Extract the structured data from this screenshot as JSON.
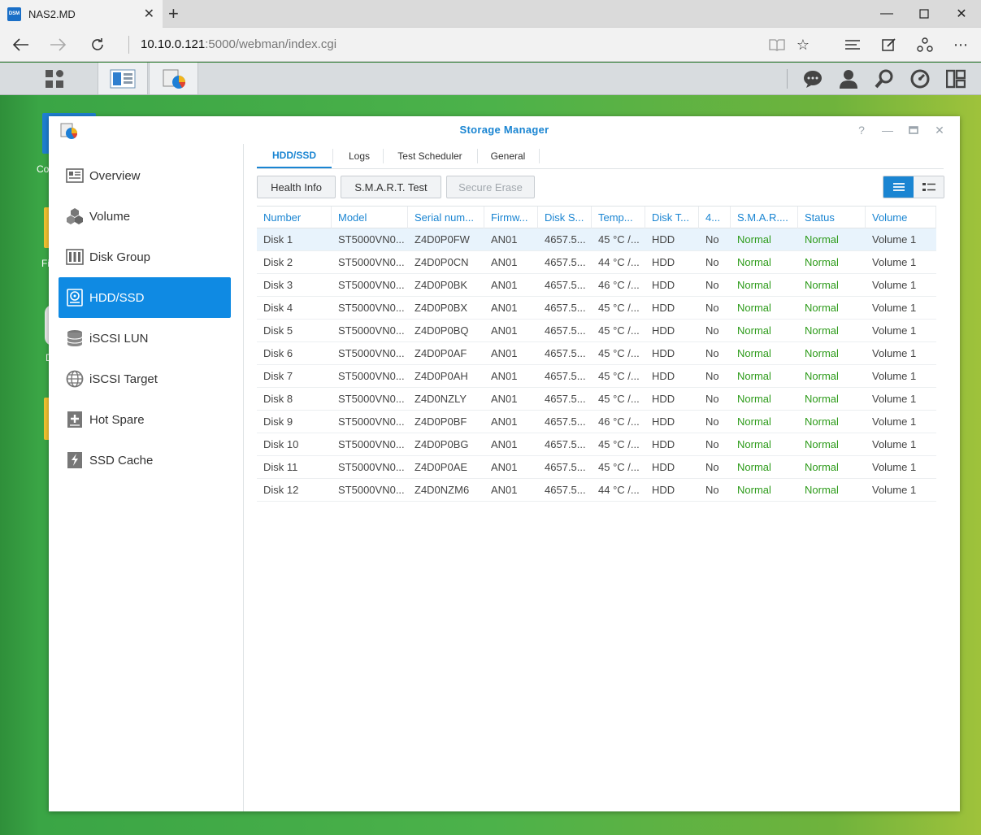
{
  "browser": {
    "tab_title": "NAS2.MD",
    "favicon_text": "DSM",
    "url_host": "10.10.0.121",
    "url_rest": ":5000/webman/index.cgi"
  },
  "desktop": {
    "labels": [
      "Co",
      "Fi",
      "D"
    ]
  },
  "window": {
    "title": "Storage Manager"
  },
  "sidebar": {
    "items": [
      {
        "label": "Overview",
        "icon": "overview-icon"
      },
      {
        "label": "Volume",
        "icon": "volume-icon"
      },
      {
        "label": "Disk Group",
        "icon": "disk-group-icon"
      },
      {
        "label": "HDD/SSD",
        "icon": "hdd-icon",
        "active": true
      },
      {
        "label": "iSCSI LUN",
        "icon": "iscsi-lun-icon"
      },
      {
        "label": "iSCSI Target",
        "icon": "iscsi-target-icon"
      },
      {
        "label": "Hot Spare",
        "icon": "hot-spare-icon"
      },
      {
        "label": "SSD Cache",
        "icon": "ssd-cache-icon"
      }
    ]
  },
  "tabs": [
    "HDD/SSD",
    "Logs",
    "Test Scheduler",
    "General"
  ],
  "toolbar": {
    "health_info": "Health Info",
    "smart_test": "S.M.A.R.T. Test",
    "secure_erase": "Secure Erase"
  },
  "table": {
    "columns": [
      "Number",
      "Model",
      "Serial num...",
      "Firmw...",
      "Disk S...",
      "Temp...",
      "Disk T...",
      "4...",
      "S.M.A.R....",
      "Status",
      "Volume"
    ],
    "rows": [
      [
        "Disk 1",
        "ST5000VN0...",
        "Z4D0P0FW",
        "AN01",
        "4657.5...",
        "45 °C /...",
        "HDD",
        "No",
        "Normal",
        "Normal",
        "Volume 1"
      ],
      [
        "Disk 2",
        "ST5000VN0...",
        "Z4D0P0CN",
        "AN01",
        "4657.5...",
        "44 °C /...",
        "HDD",
        "No",
        "Normal",
        "Normal",
        "Volume 1"
      ],
      [
        "Disk 3",
        "ST5000VN0...",
        "Z4D0P0BK",
        "AN01",
        "4657.5...",
        "46 °C /...",
        "HDD",
        "No",
        "Normal",
        "Normal",
        "Volume 1"
      ],
      [
        "Disk 4",
        "ST5000VN0...",
        "Z4D0P0BX",
        "AN01",
        "4657.5...",
        "45 °C /...",
        "HDD",
        "No",
        "Normal",
        "Normal",
        "Volume 1"
      ],
      [
        "Disk 5",
        "ST5000VN0...",
        "Z4D0P0BQ",
        "AN01",
        "4657.5...",
        "45 °C /...",
        "HDD",
        "No",
        "Normal",
        "Normal",
        "Volume 1"
      ],
      [
        "Disk 6",
        "ST5000VN0...",
        "Z4D0P0AF",
        "AN01",
        "4657.5...",
        "45 °C /...",
        "HDD",
        "No",
        "Normal",
        "Normal",
        "Volume 1"
      ],
      [
        "Disk 7",
        "ST5000VN0...",
        "Z4D0P0AH",
        "AN01",
        "4657.5...",
        "45 °C /...",
        "HDD",
        "No",
        "Normal",
        "Normal",
        "Volume 1"
      ],
      [
        "Disk 8",
        "ST5000VN0...",
        "Z4D0NZLY",
        "AN01",
        "4657.5...",
        "45 °C /...",
        "HDD",
        "No",
        "Normal",
        "Normal",
        "Volume 1"
      ],
      [
        "Disk 9",
        "ST5000VN0...",
        "Z4D0P0BF",
        "AN01",
        "4657.5...",
        "46 °C /...",
        "HDD",
        "No",
        "Normal",
        "Normal",
        "Volume 1"
      ],
      [
        "Disk 10",
        "ST5000VN0...",
        "Z4D0P0BG",
        "AN01",
        "4657.5...",
        "45 °C /...",
        "HDD",
        "No",
        "Normal",
        "Normal",
        "Volume 1"
      ],
      [
        "Disk 11",
        "ST5000VN0...",
        "Z4D0P0AE",
        "AN01",
        "4657.5...",
        "45 °C /...",
        "HDD",
        "No",
        "Normal",
        "Normal",
        "Volume 1"
      ],
      [
        "Disk 12",
        "ST5000VN0...",
        "Z4D0NZM6",
        "AN01",
        "4657.5...",
        "44 °C /...",
        "HDD",
        "No",
        "Normal",
        "Normal",
        "Volume 1"
      ]
    ]
  },
  "colors": {
    "accent": "#1a85d2",
    "selected_nav": "#0f8ae3",
    "status_ok": "#2d9b1a"
  }
}
